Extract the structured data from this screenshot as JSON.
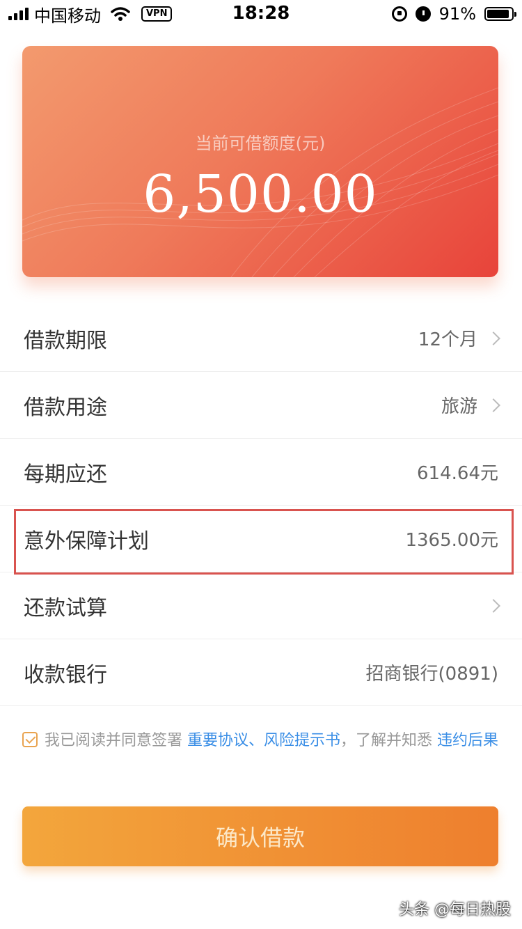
{
  "status_bar": {
    "carrier": "中国移动",
    "vpn": "VPN",
    "time": "18:28",
    "battery": "91%",
    "battery_level": 0.91
  },
  "card": {
    "label": "当前可借额度(元)",
    "amount": "6,500.00"
  },
  "rows": [
    {
      "label": "借款期限",
      "value": "12个月",
      "chevron": true
    },
    {
      "label": "借款用途",
      "value": "旅游",
      "chevron": true
    },
    {
      "label": "每期应还",
      "value": "614.64元",
      "chevron": false
    },
    {
      "label": "意外保障计划",
      "value": "1365.00元",
      "chevron": false
    },
    {
      "label": "还款试算",
      "value": "",
      "chevron": true
    },
    {
      "label": "收款银行",
      "value": "招商银行(0891)",
      "chevron": false
    }
  ],
  "agreement": {
    "prefix": "我已阅读并同意签署",
    "link1": "重要协议、风险提示书",
    "middle": "，了解并知悉",
    "link2": "违约后果"
  },
  "confirm_label": "确认借款",
  "watermark": "头条 @每日热股",
  "colors": {
    "card_start": "#f39a6e",
    "card_end": "#e8433a",
    "button_start": "#f3a63c",
    "button_end": "#ee7f2e",
    "link": "#3a8ee6",
    "highlight": "#d9534f"
  }
}
